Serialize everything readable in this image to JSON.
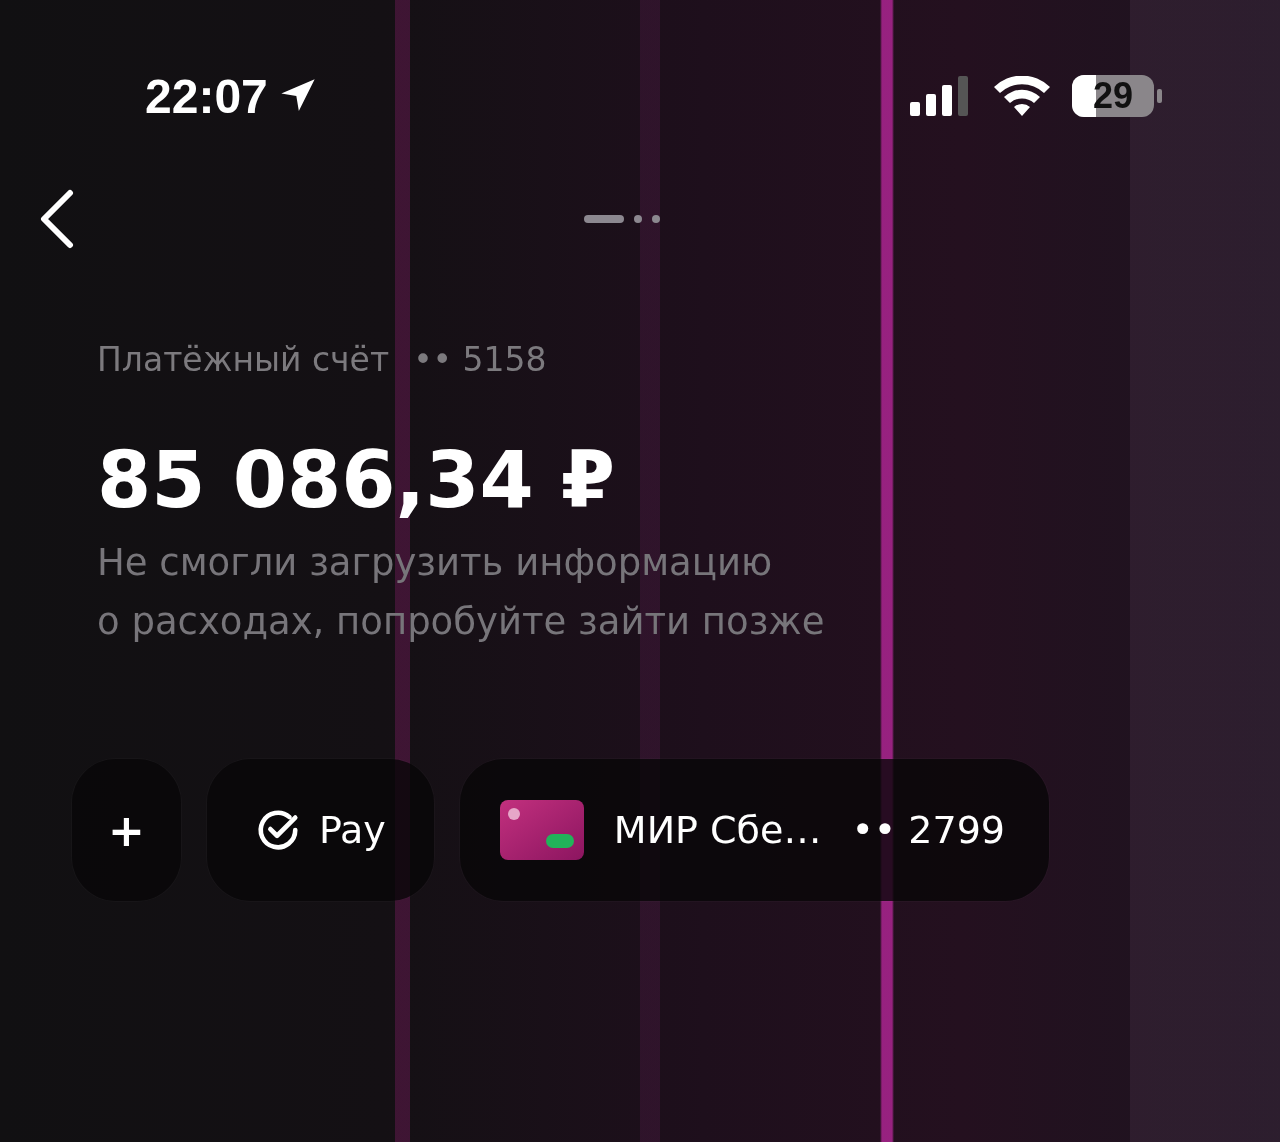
{
  "status_bar": {
    "time": "22:07",
    "battery": "29"
  },
  "pager": [
    {
      "selected": true
    },
    {
      "selected": false
    },
    {
      "selected": false
    }
  ],
  "account": {
    "label": "Платёжный счёт",
    "number": "•• 5158"
  },
  "balance": "85 086,34 ₽",
  "message_lines": [
    "Не смогли загрузить информацию",
    "о расходах, попробуйте зайти позже"
  ],
  "actions": [
    {
      "kind": "add",
      "label": "+"
    },
    {
      "kind": "pay",
      "label": "Pay"
    },
    {
      "kind": "card",
      "label": "МИР Сбе…",
      "number": "•• 2799"
    }
  ]
}
